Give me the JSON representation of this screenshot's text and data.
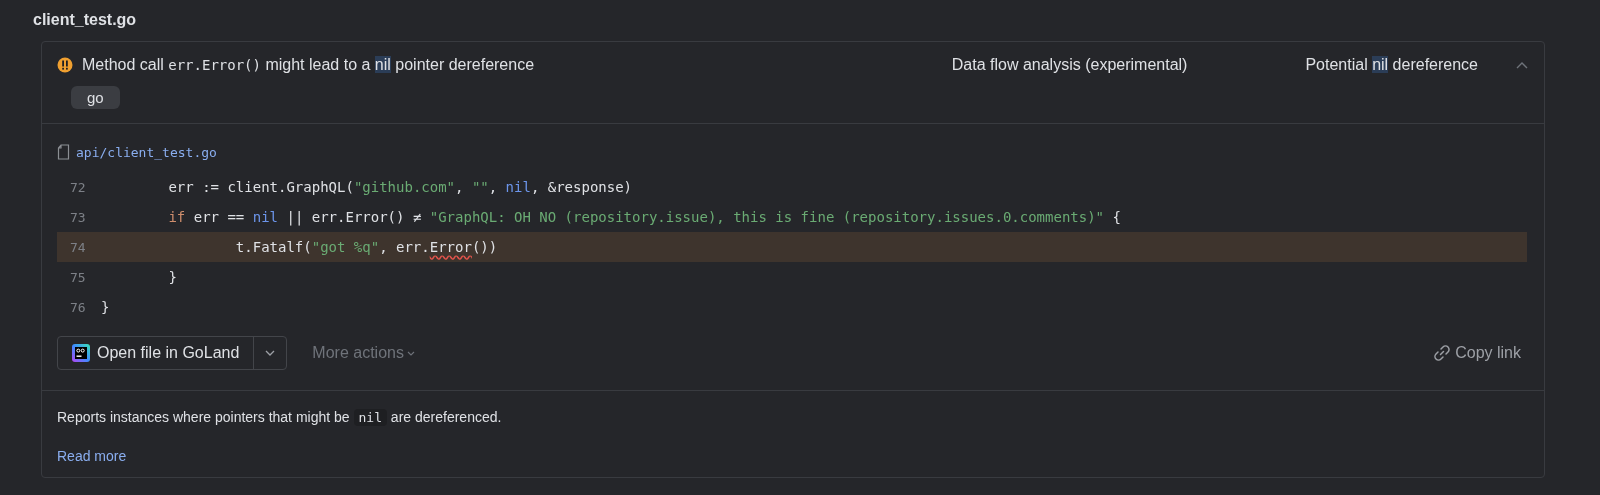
{
  "file_title": "client_test.go",
  "problem": {
    "message": [
      {
        "kind": "text",
        "text": "Method call "
      },
      {
        "kind": "code",
        "text": "err.Error()"
      },
      {
        "kind": "text",
        "text": " might lead to a "
      },
      {
        "kind": "match",
        "text": "nil"
      },
      {
        "kind": "text",
        "text": " pointer dereference"
      }
    ],
    "category": "Data flow analysis (experimental)",
    "inspection": [
      {
        "kind": "text",
        "text": "Potential "
      },
      {
        "kind": "match",
        "text": "nil"
      },
      {
        "kind": "text",
        "text": " dereference"
      }
    ],
    "expanded": true,
    "tags": [
      "go"
    ]
  },
  "file_path": "api/client_test.go",
  "code_lines": [
    {
      "number": "72",
      "highlighted": false,
      "tokens": [
        {
          "kind": "plain",
          "text": "\terr := client.GraphQL("
        },
        {
          "kind": "string",
          "text": "\"github.com\""
        },
        {
          "kind": "plain",
          "text": ", "
        },
        {
          "kind": "string",
          "text": "\"\""
        },
        {
          "kind": "plain",
          "text": ", "
        },
        {
          "kind": "nil",
          "text": "nil"
        },
        {
          "kind": "plain",
          "text": ", &response)"
        }
      ]
    },
    {
      "number": "73",
      "highlighted": false,
      "tokens": [
        {
          "kind": "keyword",
          "text": "\tif"
        },
        {
          "kind": "plain",
          "text": " err == "
        },
        {
          "kind": "nil",
          "text": "nil"
        },
        {
          "kind": "plain",
          "text": " || err.Error() ≠ "
        },
        {
          "kind": "string",
          "text": "\"GraphQL: OH NO (repository.issue), this is fine (repository.issues.0.comments)\""
        },
        {
          "kind": "plain",
          "text": " {"
        }
      ]
    },
    {
      "number": "74",
      "highlighted": true,
      "tokens": [
        {
          "kind": "plain",
          "text": "\t\tt.Fatalf("
        },
        {
          "kind": "string",
          "text": "\"got %q\""
        },
        {
          "kind": "plain",
          "text": ", err."
        },
        {
          "kind": "warn",
          "text": "Error"
        },
        {
          "kind": "plain",
          "text": "())"
        }
      ]
    },
    {
      "number": "75",
      "highlighted": false,
      "tokens": [
        {
          "kind": "plain",
          "text": "\t}"
        }
      ]
    },
    {
      "number": "76",
      "highlighted": false,
      "tokens": [
        {
          "kind": "plain",
          "text": "}"
        }
      ]
    }
  ],
  "actions": {
    "open_button": "Open file in GoLand",
    "more_actions": "More actions",
    "copy_link": "Copy link"
  },
  "description": [
    {
      "kind": "text",
      "text": "Reports instances where pointers that might be "
    },
    {
      "kind": "code",
      "text": "nil"
    },
    {
      "kind": "text",
      "text": " are dereferenced."
    }
  ],
  "read_more": "Read more"
}
